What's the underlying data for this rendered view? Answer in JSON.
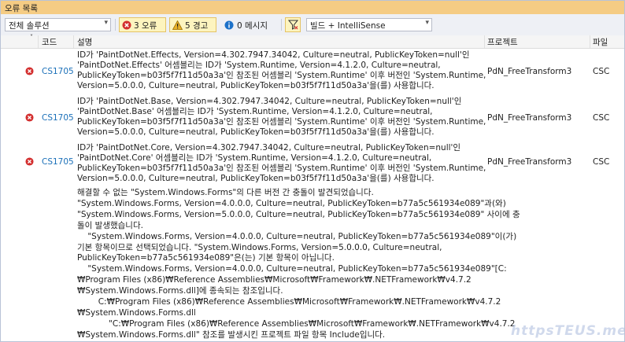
{
  "window": {
    "title": "오류 목록"
  },
  "toolbar": {
    "scope": "전체 솔루션",
    "errors": "3 오류",
    "warnings": "5 경고",
    "messages": "0 메시지",
    "build": "빌드 + IntelliSense"
  },
  "columns": {
    "code": "코드",
    "desc": "설명",
    "project": "프로젝트",
    "file": "파일"
  },
  "rows": [
    {
      "code": "CS1705",
      "desc": "ID가 'PaintDotNet.Effects, Version=4.302.7947.34042, Culture=neutral, PublicKeyToken=null'인\n'PaintDotNet.Effects' 어셈블리는 ID가 'System.Runtime, Version=4.1.2.0, Culture=neutral,\nPublicKeyToken=b03f5f7f11d50a3a'인 참조된 어셈블리 'System.Runtime' 이후 버전인 'System.Runtime,\nVersion=5.0.0.0, Culture=neutral, PublicKeyToken=b03f5f7f11d50a3a'을(를) 사용합니다.",
      "project": "PdN_FreeTransform3",
      "file": "CSC"
    },
    {
      "code": "CS1705",
      "desc": "ID가 'PaintDotNet.Base, Version=4.302.7947.34042, Culture=neutral, PublicKeyToken=null'인\n'PaintDotNet.Base' 어셈블리는 ID가 'System.Runtime, Version=4.1.2.0, Culture=neutral,\nPublicKeyToken=b03f5f7f11d50a3a'인 참조된 어셈블리 'System.Runtime' 이후 버전인 'System.Runtime,\nVersion=5.0.0.0, Culture=neutral, PublicKeyToken=b03f5f7f11d50a3a'을(를) 사용합니다.",
      "project": "PdN_FreeTransform3",
      "file": "CSC"
    },
    {
      "code": "CS1705",
      "desc": "ID가 'PaintDotNet.Core, Version=4.302.7947.34042, Culture=neutral, PublicKeyToken=null'인\n'PaintDotNet.Core' 어셈블리는 ID가 'System.Runtime, Version=4.1.2.0, Culture=neutral,\nPublicKeyToken=b03f5f7f11d50a3a'인 참조된 어셈블리 'System.Runtime' 이후 버전인 'System.Runtime,\nVersion=5.0.0.0, Culture=neutral, PublicKeyToken=b03f5f7f11d50a3a'을(를) 사용합니다.",
      "project": "PdN_FreeTransform3",
      "file": "CSC"
    }
  ],
  "warning_detail": "해결할 수 없는 \"System.Windows.Forms\"의 다른 버전 간 충돌이 발견되었습니다.\n\"System.Windows.Forms, Version=4.0.0.0, Culture=neutral, PublicKeyToken=b77a5c561934e089\"과(와)\n\"System.Windows.Forms, Version=5.0.0.0, Culture=neutral, PublicKeyToken=b77a5c561934e089\" 사이에 충\n돌이 발생했습니다.\n    \"System.Windows.Forms, Version=4.0.0.0, Culture=neutral, PublicKeyToken=b77a5c561934e089\"이(가)\n기본 항목이므로 선택되었습니다. \"System.Windows.Forms, Version=5.0.0.0, Culture=neutral,\nPublicKeyToken=b77a5c561934e089\"은(는) 기본 항목이 아닙니다.\n    \"System.Windows.Forms, Version=4.0.0.0, Culture=neutral, PublicKeyToken=b77a5c561934e089\"[C:\n₩Program Files (x86)₩Reference Assemblies₩Microsoft₩Framework₩.NETFramework₩v4.7.2\n₩System.Windows.Forms.dll]에 종속되는 참조입니다.\n        C:₩Program Files (x86)₩Reference Assemblies₩Microsoft₩Framework₩.NETFramework₩v4.7.2\n₩System.Windows.Forms.dll\n            \"C:₩Program Files (x86)₩Reference Assemblies₩Microsoft₩Framework₩.NETFramework₩v4.7.2\n₩System.Windows.Forms.dll\" 참조를 발생시킨 프로젝트 파일 항목 Include입니다.\n            System.Windows.Forms",
  "watermark": "httpsTEUS.me",
  "colors": {
    "title_bg": "#f5cc84",
    "error_red": "#d32f2f",
    "code_link": "#1a6fb8",
    "toolbar_bg": "#eef0f5"
  }
}
